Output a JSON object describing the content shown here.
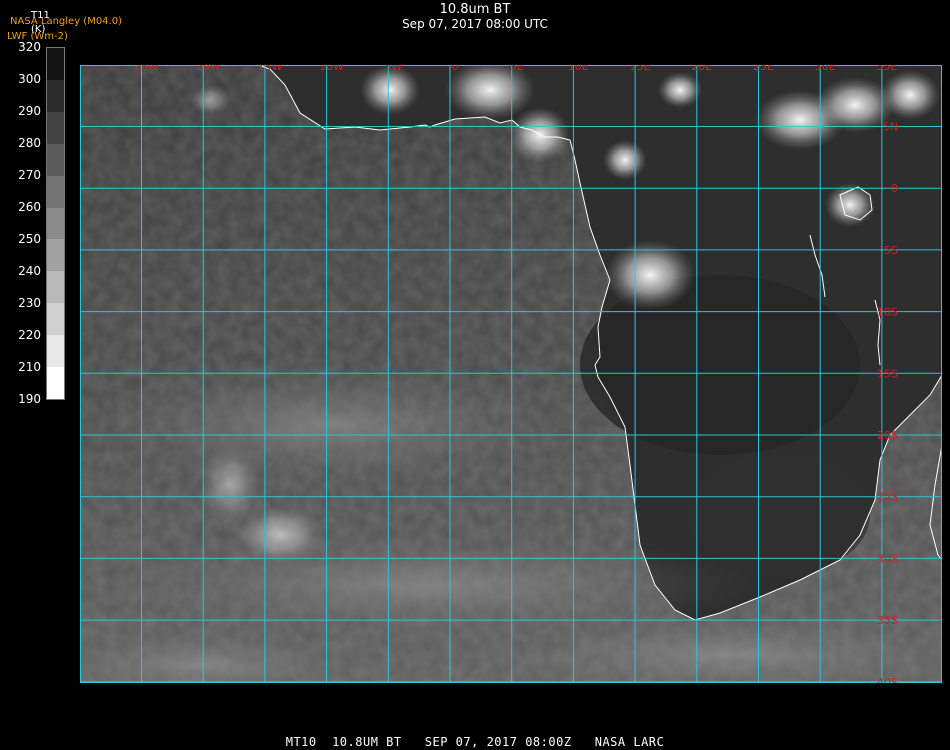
{
  "header": {
    "title": "10.8um BT",
    "subtitle": "Sep 07, 2017 08:00 UTC",
    "credit_line1": "NASA Langley (M04.0)",
    "credit_line2": "LWF (Wm-2)"
  },
  "colorbar": {
    "variable": "T11",
    "unit": "(K)",
    "ticks": [
      "320",
      "300",
      "290",
      "280",
      "270",
      "260",
      "250",
      "240",
      "230",
      "220",
      "210",
      "190"
    ]
  },
  "map": {
    "lon_labels": [
      "25W",
      "20W",
      "15W",
      "10W",
      "5W",
      "0",
      "5E",
      "10E",
      "15E",
      "20E",
      "25E",
      "30E",
      "35E"
    ],
    "lat_labels": [
      "5N",
      "0",
      "5S",
      "10S",
      "15S",
      "20S",
      "25S",
      "30S",
      "35S",
      "40S"
    ],
    "grid_color": "#28c8d8",
    "label_color": "#d42020",
    "coast_color": "#ffffff"
  },
  "footer": {
    "text": "MT10  10.8UM BT   SEP 07, 2017 08:00Z   NASA LARC"
  }
}
